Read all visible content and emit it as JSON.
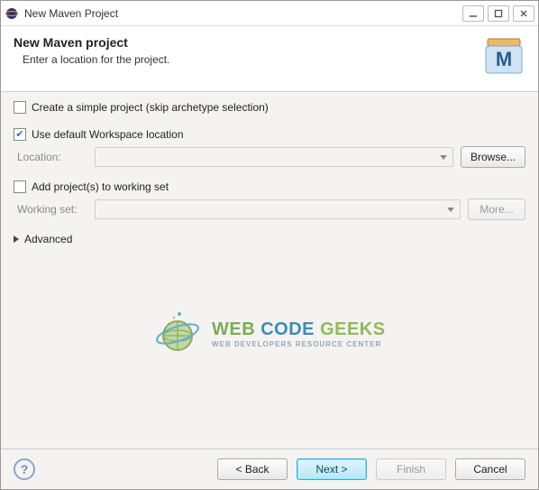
{
  "titlebar": {
    "title": "New Maven Project"
  },
  "header": {
    "title": "New Maven project",
    "subtitle": "Enter a location for the project."
  },
  "options": {
    "simple_project_label": "Create a simple project (skip archetype selection)",
    "default_workspace_label": "Use default Workspace location",
    "location_label": "Location:",
    "browse_label": "Browse...",
    "add_working_set_label": "Add project(s) to working set",
    "working_set_label": "Working set:",
    "more_label": "More...",
    "advanced_label": "Advanced"
  },
  "watermark": {
    "line1_a": "WEB ",
    "line1_b": "CODE ",
    "line1_c": "GEEKS",
    "line2": "WEB DEVELOPERS RESOURCE CENTER"
  },
  "footer": {
    "back": "< Back",
    "next": "Next >",
    "finish": "Finish",
    "cancel": "Cancel"
  }
}
